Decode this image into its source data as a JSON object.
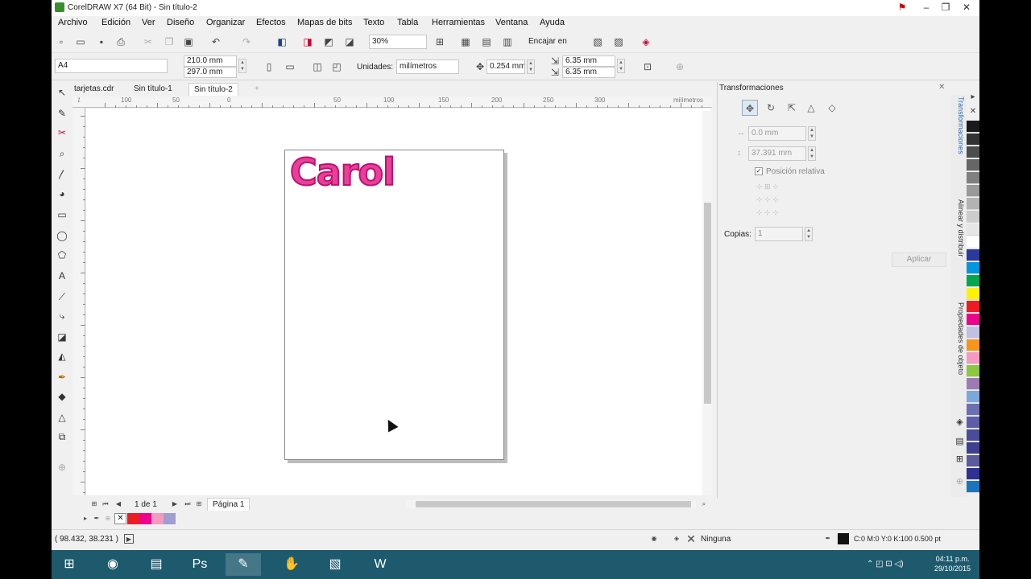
{
  "window": {
    "title": "CorelDRAW X7 (64 Bit) - Sin título-2"
  },
  "menu": [
    "Archivo",
    "Edición",
    "Ver",
    "Diseño",
    "Organizar",
    "Efectos",
    "Mapas de bits",
    "Texto",
    "Tabla",
    "Herramientas",
    "Ventana",
    "Ayuda"
  ],
  "toolbar": {
    "zoom_value": "30%",
    "snap_label": "Encajar en"
  },
  "propbar": {
    "page_size": "A4",
    "width": "210.0 mm",
    "height": "297.0 mm",
    "units_label": "Unidades:",
    "units_value": "milímetros",
    "nudge": "0.254 mm",
    "dup_x": "6.35 mm",
    "dup_y": "6.35 mm"
  },
  "doc_tabs": [
    {
      "label": "tarjetas.cdr",
      "active": false
    },
    {
      "label": "Sin título-1",
      "active": false
    },
    {
      "label": "Sin título-2",
      "active": true
    }
  ],
  "ruler": {
    "h_labels": [
      "100",
      "50",
      "0",
      "50",
      "100",
      "150",
      "200",
      "250",
      "300"
    ],
    "units": "milímetros"
  },
  "canvas": {
    "artwork_text": "Carol"
  },
  "page_nav": {
    "page_count": "1 de 1",
    "page_tab": "Página 1"
  },
  "status": {
    "coords": "( 98.432, 38.231 )",
    "fill_label": "Ninguna",
    "outline": "C:0 M:0 Y:0 K:100  0.500 pt"
  },
  "docker": {
    "title": "Transformaciones",
    "x_value": "0.0 mm",
    "y_value": "37.391 mm",
    "relative_label": "Posición relativa",
    "copies_label": "Copias:",
    "copies_value": "1",
    "apply_label": "Aplicar"
  },
  "docker_tabs": [
    "Transformaciones",
    "Alinear y distribuir",
    "Propiedades de objeto"
  ],
  "palette_colors": [
    "#1a1a1a",
    "#333333",
    "#4d4d4d",
    "#666666",
    "#808080",
    "#999999",
    "#b3b3b3",
    "#cccccc",
    "#e6e6e6",
    "#ffffff",
    "#2b3a9a",
    "#0096e0",
    "#00a650",
    "#fff200",
    "#ed1c24",
    "#ec008c",
    "#c0c0e0",
    "#f7941d",
    "#f49ac1",
    "#8dc63f",
    "#9e7bb5",
    "#7da7d9",
    "#6d6fb5",
    "#5e5ea8",
    "#4b4b9c",
    "#3f3f8f",
    "#5a5a9c",
    "#2e3192",
    "#1b75bb"
  ],
  "doc_palette": [
    "#ed1c24",
    "#ec008c",
    "#f49ac1",
    "#9e9ed0"
  ],
  "taskbar": {
    "time": "04:11 p.m.",
    "date": "29/10/2015"
  }
}
